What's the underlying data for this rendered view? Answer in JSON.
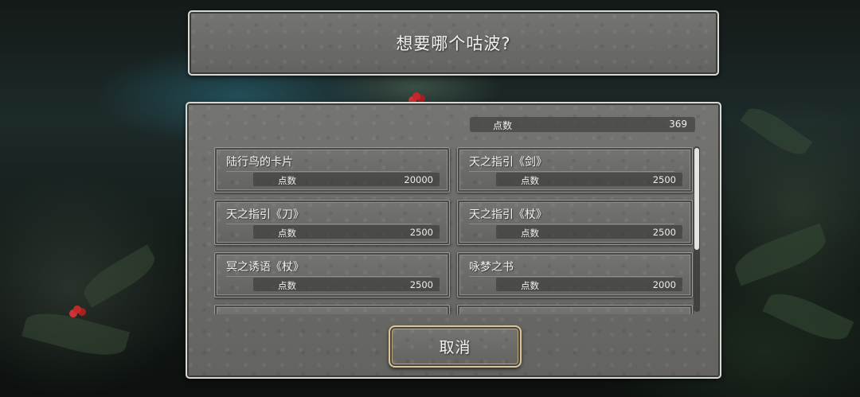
{
  "dialog": {
    "title": "想要哪个咕波?",
    "points_label": "点数",
    "points_value": "369",
    "cancel_label": "取消"
  },
  "items": [
    {
      "name": "陆行鸟的卡片",
      "cost_label": "点数",
      "cost": "20000"
    },
    {
      "name": "天之指引《剑》",
      "cost_label": "点数",
      "cost": "2500"
    },
    {
      "name": "天之指引《刀》",
      "cost_label": "点数",
      "cost": "2500"
    },
    {
      "name": "天之指引《杖》",
      "cost_label": "点数",
      "cost": "2500"
    },
    {
      "name": "冥之诱语《杖》",
      "cost_label": "点数",
      "cost": "2500"
    },
    {
      "name": "咏梦之书",
      "cost_label": "点数",
      "cost": "2000"
    },
    {
      "name": "",
      "cost_label": "",
      "cost": ""
    },
    {
      "name": "",
      "cost_label": "",
      "cost": ""
    }
  ],
  "scroll": {
    "visible_fraction": 0.62,
    "position": 0.0
  }
}
